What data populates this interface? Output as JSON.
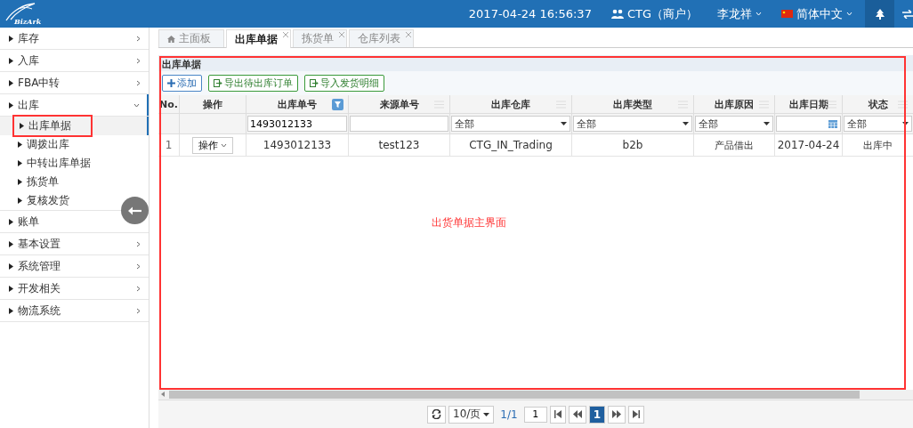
{
  "header": {
    "logo": "BizArk",
    "datetime": "2017-04-24 16:56:37",
    "merchant": "CTG（商户）",
    "user": "李龙祥",
    "language": "简体中文"
  },
  "sidebar": {
    "items": [
      {
        "label": "库存",
        "expanded": false
      },
      {
        "label": "入库",
        "expanded": false
      },
      {
        "label": "FBA中转",
        "expanded": false
      },
      {
        "label": "出库",
        "expanded": true,
        "children": [
          {
            "label": "出库单据",
            "selected": true
          },
          {
            "label": "调拨出库",
            "selected": false
          },
          {
            "label": "中转出库单据",
            "selected": false
          },
          {
            "label": "拣货单",
            "selected": false
          },
          {
            "label": "复核发货",
            "selected": false
          }
        ]
      },
      {
        "label": "账单",
        "expanded": false
      },
      {
        "label": "基本设置",
        "expanded": false
      },
      {
        "label": "系统管理",
        "expanded": false
      },
      {
        "label": "开发相关",
        "expanded": false
      },
      {
        "label": "物流系统",
        "expanded": false
      }
    ]
  },
  "tabs": [
    {
      "label": "主面板",
      "selected": false,
      "closable": false
    },
    {
      "label": "出库单据",
      "selected": true,
      "closable": true
    },
    {
      "label": "拣货单",
      "selected": false,
      "closable": true
    },
    {
      "label": "仓库列表",
      "selected": false,
      "closable": true
    }
  ],
  "panel": {
    "title": "出库单据",
    "buttons": [
      {
        "label": "添加",
        "kind": "add"
      },
      {
        "label": "导出待出库订单",
        "kind": "export"
      },
      {
        "label": "导入发货明细",
        "kind": "export"
      }
    ]
  },
  "table": {
    "columns": [
      {
        "label": "No.",
        "filter": {
          "kind": "none"
        }
      },
      {
        "label": "操作",
        "filter": {
          "kind": "none"
        }
      },
      {
        "label": "出库单号",
        "filter": {
          "kind": "text",
          "value": "1493012133"
        }
      },
      {
        "label": "来源单号",
        "filter": {
          "kind": "text"
        }
      },
      {
        "label": "出库仓库",
        "filter": {
          "kind": "select",
          "value": "全部"
        }
      },
      {
        "label": "出库类型",
        "filter": {
          "kind": "select",
          "value": "全部"
        }
      },
      {
        "label": "出库原因",
        "filter": {
          "kind": "select",
          "value": "全部"
        }
      },
      {
        "label": "出库日期",
        "filter": {
          "kind": "date"
        }
      },
      {
        "label": "状态",
        "filter": {
          "kind": "select",
          "value": "全部"
        }
      }
    ],
    "rows": [
      {
        "cells": [
          "1",
          "操作",
          "1493012133",
          "test123",
          "CTG_IN_Trading",
          "b2b",
          "产品借出",
          "2017-04-24",
          "出库中"
        ]
      }
    ]
  },
  "annotation": "出货单据主界面",
  "pager": {
    "page_size": "10/页",
    "pages": "1/1",
    "page_input": "1",
    "current": "1"
  }
}
